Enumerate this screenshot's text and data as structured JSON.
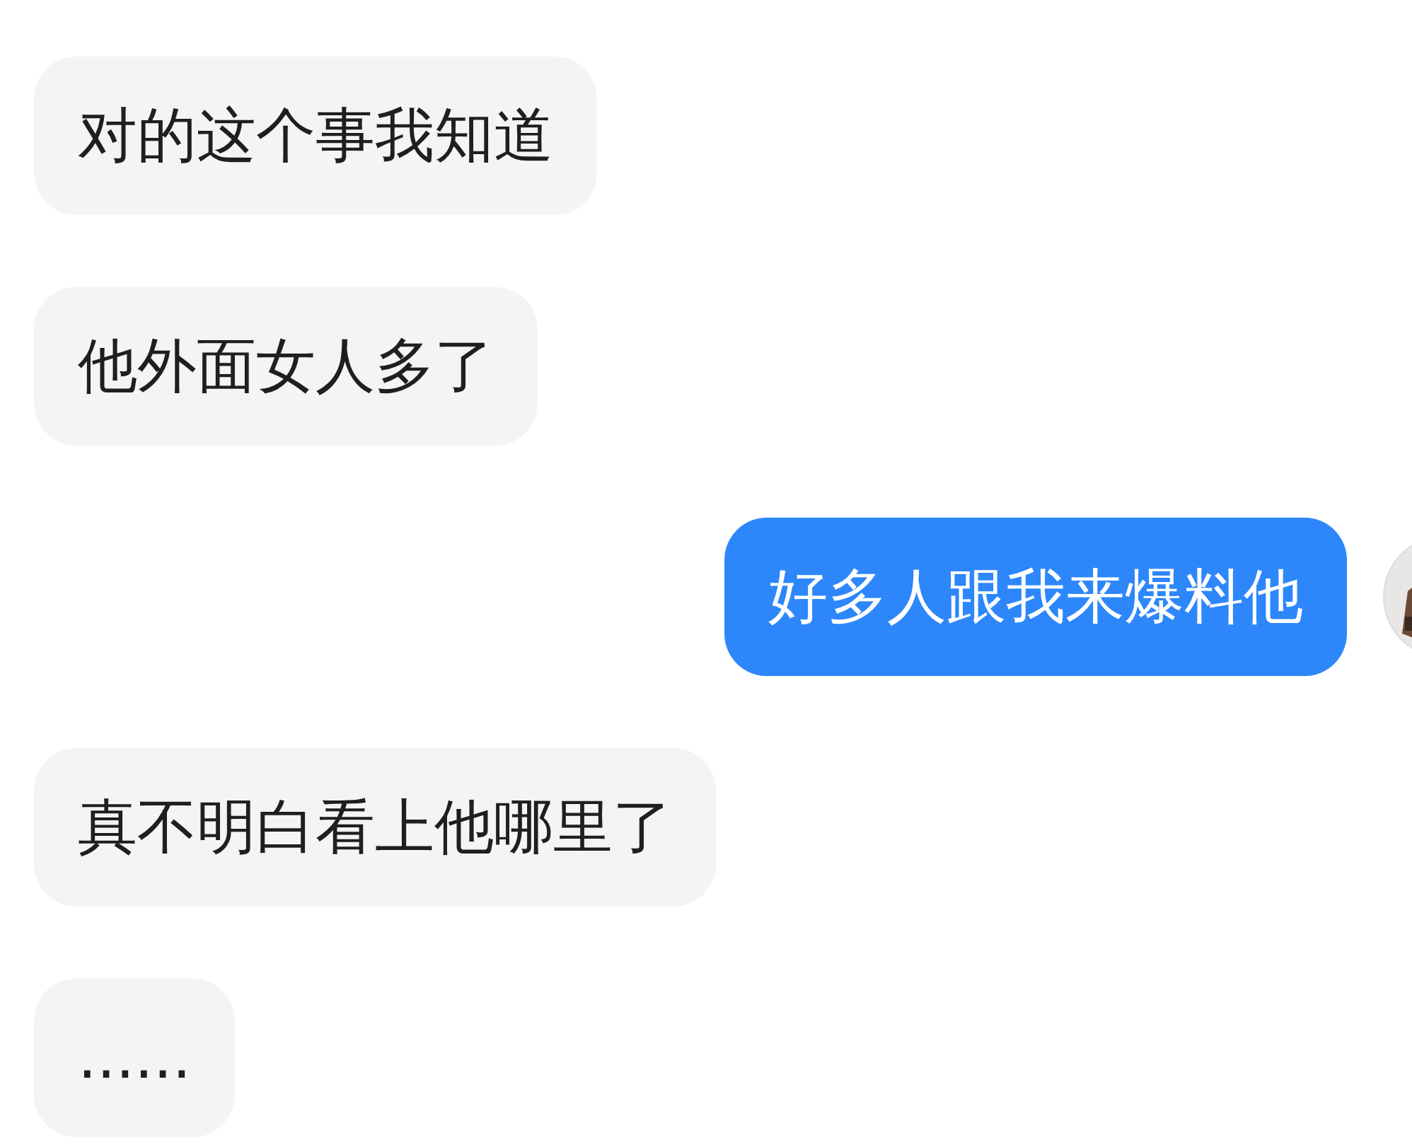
{
  "messages": [
    {
      "kind": "incoming",
      "text": "对的这个事我知道"
    },
    {
      "kind": "incoming",
      "text": "他外面女人多了"
    },
    {
      "kind": "outgoing",
      "text": "好多人跟我来爆料他"
    },
    {
      "kind": "incoming",
      "text": "真不明白看上他哪里了"
    },
    {
      "kind": "incoming",
      "text": "......"
    }
  ]
}
